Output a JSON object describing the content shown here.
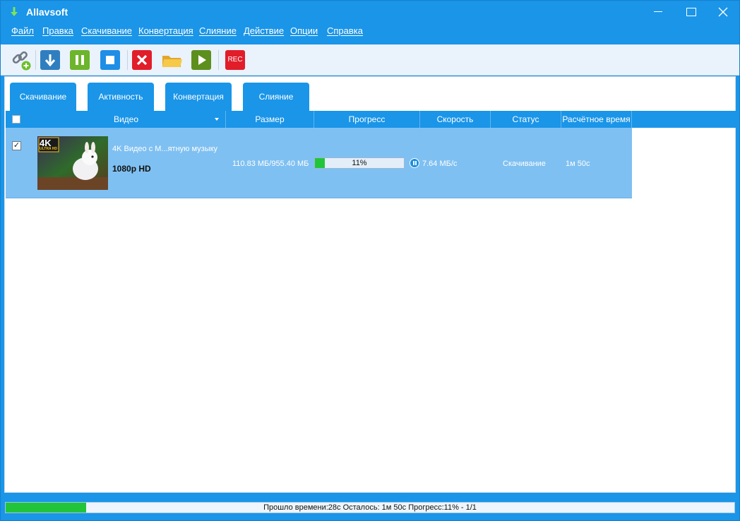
{
  "window": {
    "title": "Allavsoft",
    "brand_color": "#1a95e8"
  },
  "menu": [
    "Файл",
    "Правка",
    "Скачивание",
    "Конвертация",
    "Слияние",
    "Действие",
    "Опции",
    "Справка"
  ],
  "toolbar": {
    "buttons": [
      {
        "name": "add-url-button",
        "icon": "link-add-icon"
      },
      {
        "name": "download-button",
        "icon": "download-arrow-icon"
      },
      {
        "name": "pause-button",
        "icon": "pause-icon"
      },
      {
        "name": "stop-button",
        "icon": "stop-icon"
      },
      {
        "name": "delete-button",
        "icon": "close-x-icon"
      },
      {
        "name": "open-folder-button",
        "icon": "folder-icon"
      },
      {
        "name": "play-button",
        "icon": "play-icon"
      },
      {
        "name": "record-button",
        "icon": "rec-icon",
        "label": "REC"
      }
    ]
  },
  "tabs": [
    "Скачивание",
    "Активность",
    "Конвертация",
    "Слияние"
  ],
  "columns": {
    "video": "Видео",
    "size": "Размер",
    "progress": "Прогресс",
    "speed": "Скорость",
    "status": "Статус",
    "eta": "Расчётное время"
  },
  "rows": [
    {
      "checked": true,
      "thumbnail_badge": "4K",
      "thumbnail_sub_badge": "ULTRA HD",
      "title": "4K Видео с M...ятную музыку",
      "quality": "1080p HD",
      "size": "110.83 МБ/955.40 МБ",
      "progress": 0.11,
      "progress_label": "11%",
      "speed": "7.64 МБ/с",
      "status": "Скачивание",
      "eta": "1м 50с"
    }
  ],
  "statusbar": {
    "progress": 0.11,
    "text": "Прошло времени:28с Осталось:  1м 50с Прогресс:11% - 1/1"
  }
}
